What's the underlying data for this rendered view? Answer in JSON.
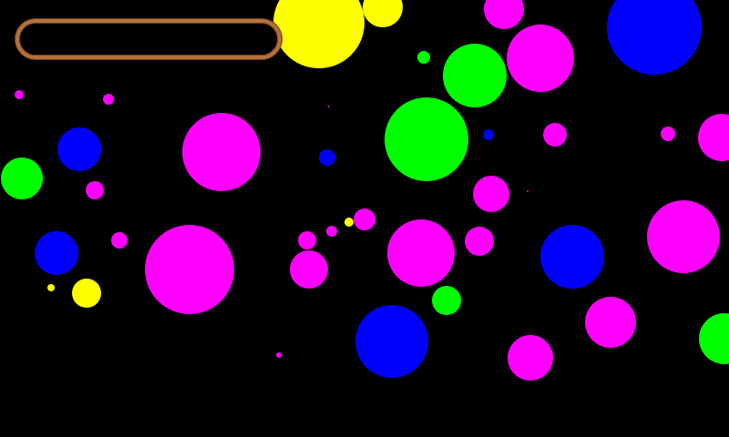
{
  "game": {
    "background_color": "#000000",
    "palette": {
      "magenta": "#ff00ff",
      "green": "#00ff00",
      "blue": "#0000ff",
      "yellow": "#ffff00"
    },
    "progress_bar": {
      "frame_color": "#b5713a",
      "fill_fraction": 0
    }
  }
}
